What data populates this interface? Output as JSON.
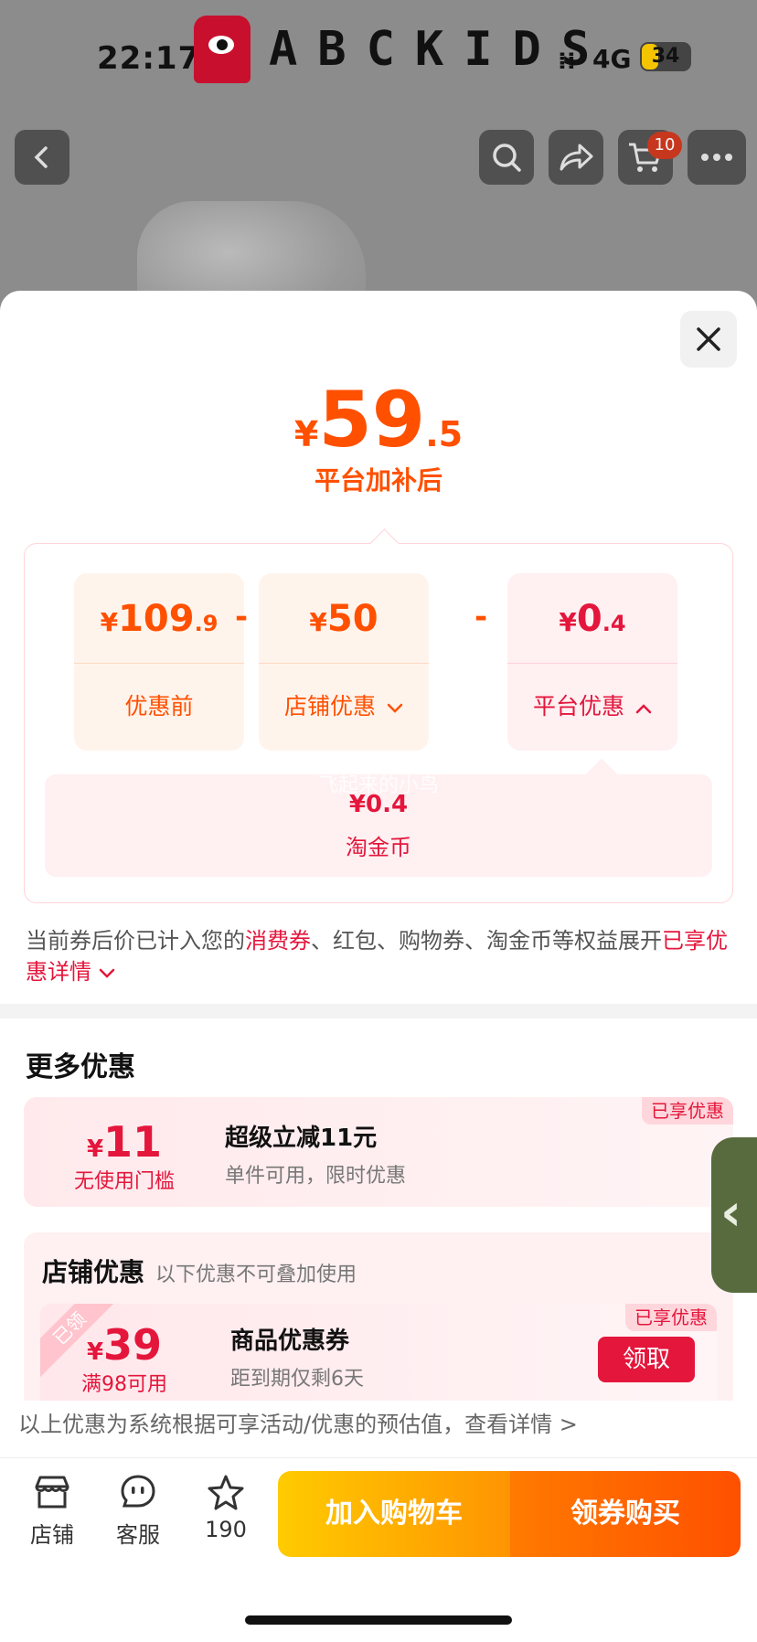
{
  "status_bar": {
    "time": "22:17",
    "signal": "⁞⁞",
    "network": "4G",
    "battery": "34"
  },
  "brand": {
    "name": "ABCKIDS"
  },
  "top_nav": {
    "cart_count": "10"
  },
  "sheet": {
    "price": {
      "currency": "¥",
      "integer": "59",
      "decimal": ".5",
      "caption": "平台加补后"
    },
    "breakdown": {
      "before": {
        "currency": "¥",
        "integer": "109",
        "decimal": ".9",
        "label": "优惠前"
      },
      "minus1": "-",
      "store": {
        "currency": "¥",
        "integer": "50",
        "label": "店铺优惠"
      },
      "minus2": "-",
      "platform": {
        "currency": "¥",
        "integer": "0",
        "decimal": ".4",
        "label": "平台优惠"
      },
      "platform_detail": {
        "value": "¥0.4",
        "label": "淘金币"
      },
      "watermark": "飞起来的小鸟"
    },
    "note": {
      "part1": "当前券后价已计入您的",
      "highlight": "消费券",
      "part2": "、红包、购物券、淘金币等权益展开",
      "link": "已享优惠详情"
    },
    "more_title": "更多优惠",
    "promo1": {
      "currency": "¥",
      "amount": "11",
      "condition": "无使用门槛",
      "title": "超级立减11元",
      "desc": "单件可用，限时优惠",
      "tag": "已享优惠"
    },
    "store_section": {
      "title": "店铺优惠",
      "hint": "以下优惠不可叠加使用",
      "coupon": {
        "ribbon": "已领",
        "currency": "¥",
        "amount": "39",
        "condition": "满98可用",
        "title": "商品优惠券",
        "desc": "距到期仅剩6天",
        "tag": "已享优惠",
        "button": "领取"
      }
    },
    "disclaimer": "以上优惠为系统根据可享活动/优惠的预估值，查看详情 >"
  },
  "bottom_bar": {
    "shop_label": "店铺",
    "service_label": "客服",
    "fav_count": "190",
    "add_cart": "加入购物车",
    "buy": "领券购买"
  },
  "colors": {
    "accent": "#ff5000",
    "red": "#e4163c",
    "pink_bg": "#fff0f2"
  }
}
